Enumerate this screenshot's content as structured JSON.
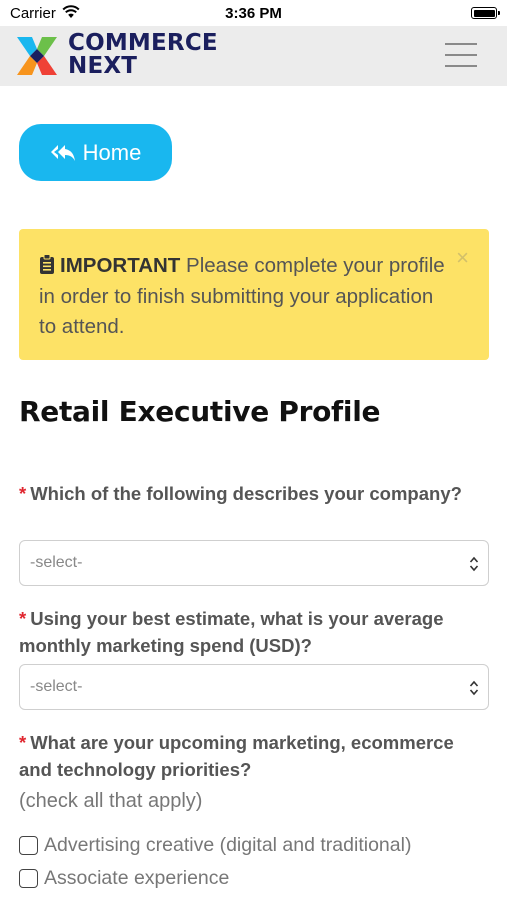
{
  "status_bar": {
    "carrier": "Carrier",
    "time": "3:36 PM"
  },
  "header": {
    "logo_line1": "COMMERCE",
    "logo_line2": "NEXT",
    "menu_icon": "hamburger-menu-icon"
  },
  "home_button": {
    "label": "Home",
    "icon": "reply-all-icon"
  },
  "alert": {
    "icon": "clipboard-icon",
    "strong": "IMPORTANT",
    "text": "Please complete your profile in order to finish submitting your application to attend.",
    "close": "×"
  },
  "page_title": "Retail Executive Profile",
  "form": {
    "required_marker": "*",
    "questions": [
      {
        "label": "Which of the following describes your company?",
        "select_value": "-select-"
      },
      {
        "label": "Using your best estimate, what is your average monthly marketing spend (USD)?",
        "select_value": "-select-"
      },
      {
        "label": "What are your upcoming marketing, ecommerce and technology priorities?"
      }
    ],
    "hint": "(check all that apply)",
    "options": [
      {
        "label": "Advertising creative (digital and traditional)",
        "checked": false
      },
      {
        "label": "Associate experience",
        "checked": false
      }
    ]
  },
  "colors": {
    "accent": "#19b7ef",
    "alert_bg": "#fde266",
    "required": "#e0262f",
    "logo_navy": "#1b1f5e"
  }
}
